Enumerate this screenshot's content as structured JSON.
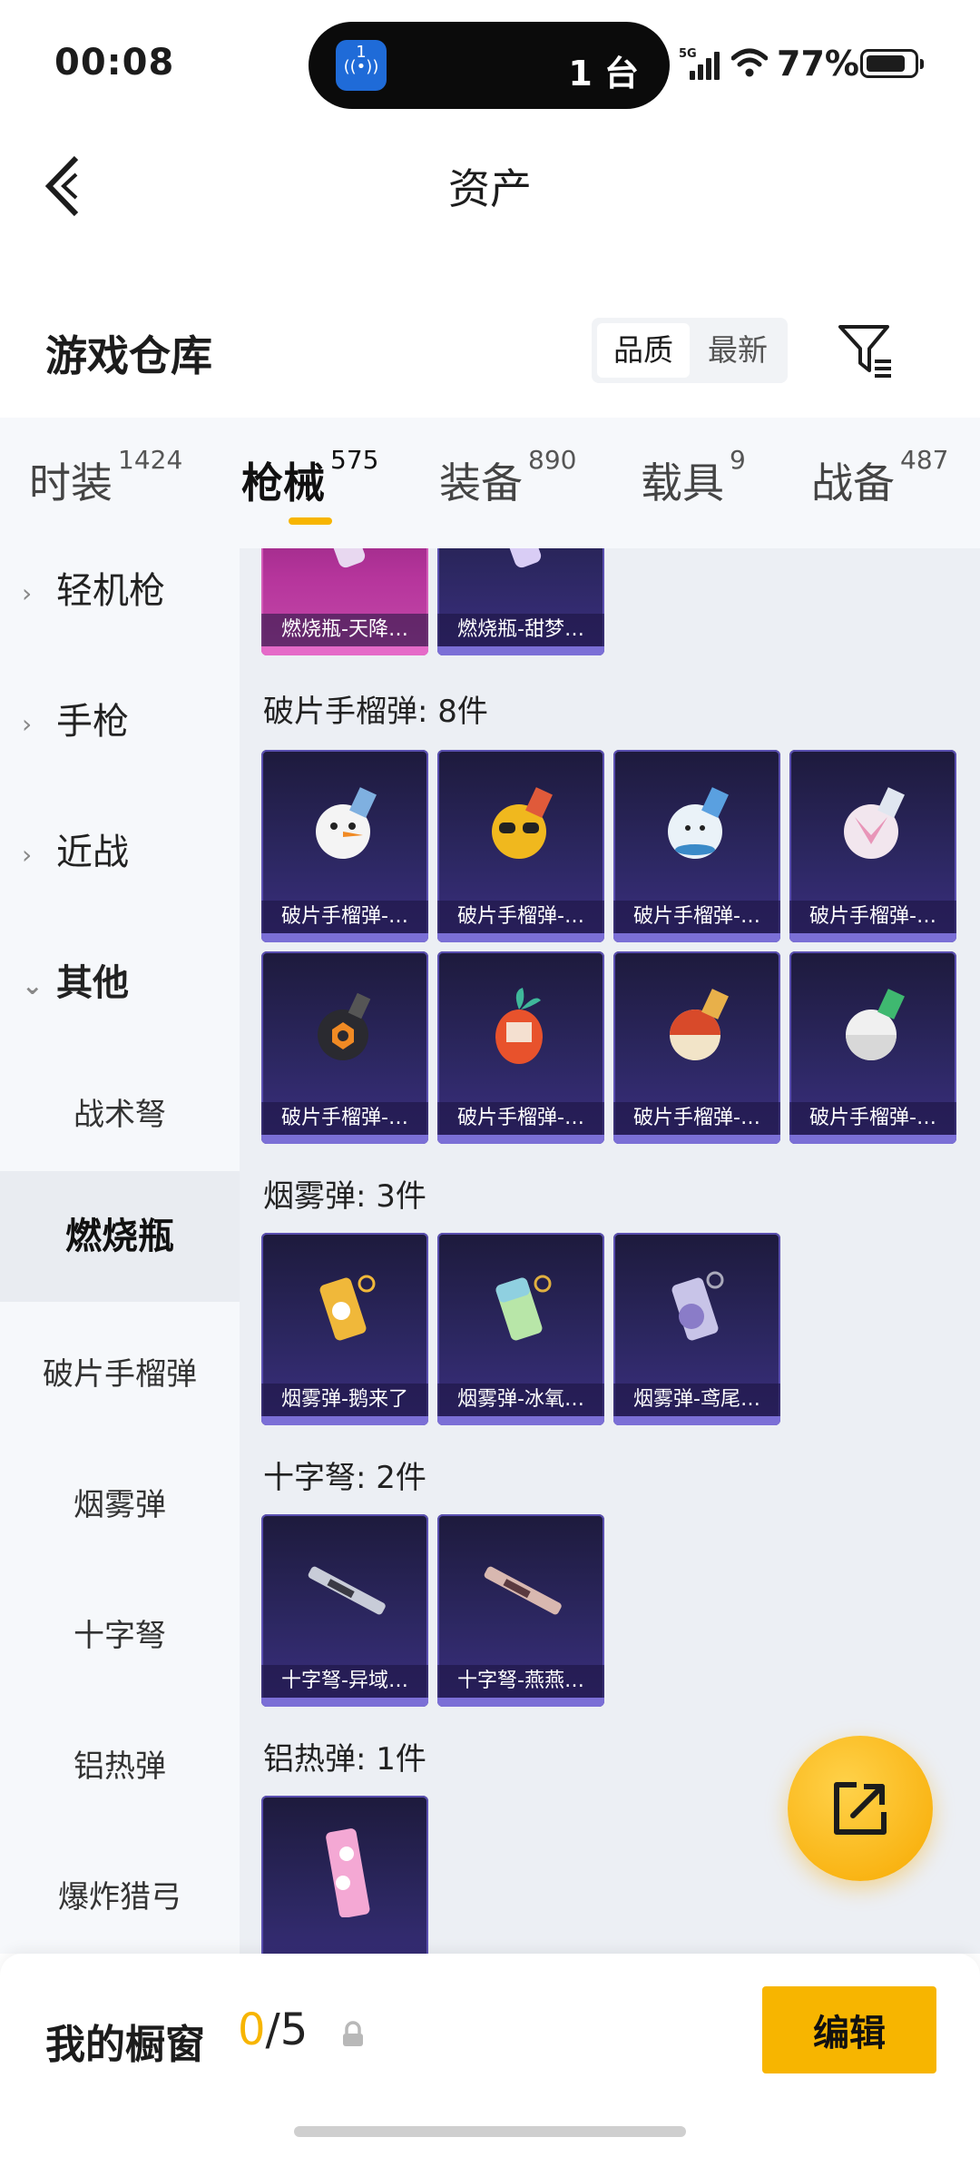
{
  "status_bar": {
    "time": "00:08",
    "island_icon": "1",
    "island_count": "1 台",
    "network": "5G",
    "battery": "77%"
  },
  "header": {
    "title": "资产"
  },
  "warehouse": {
    "title": "游戏仓库",
    "sort_options": [
      "品质",
      "最新"
    ],
    "sort_selected": "品质"
  },
  "tabs": [
    {
      "label": "时装",
      "count": "1424"
    },
    {
      "label": "枪械",
      "count": "575",
      "active": true
    },
    {
      "label": "装备",
      "count": "890"
    },
    {
      "label": "载具",
      "count": "9"
    },
    {
      "label": "战备",
      "count": "487"
    }
  ],
  "sidebar": {
    "categories": [
      "轻机枪",
      "手枪",
      "近战",
      "其他"
    ],
    "subcategories": [
      "战术弩",
      "燃烧瓶",
      "破片手榴弹",
      "烟雾弹",
      "十字弩",
      "铝热弹",
      "爆炸猎弓"
    ],
    "active": "燃烧瓶"
  },
  "sections": [
    {
      "label": "",
      "items": [
        "燃烧瓶-天降…",
        "燃烧瓶-甜梦…"
      ]
    },
    {
      "label": "破片手榴弹: 8件",
      "items": [
        "破片手榴弹-…",
        "破片手榴弹-…",
        "破片手榴弹-…",
        "破片手榴弹-…",
        "破片手榴弹-…",
        "破片手榴弹-…",
        "破片手榴弹-…",
        "破片手榴弹-…"
      ]
    },
    {
      "label": "烟雾弹: 3件",
      "items": [
        "烟雾弹-鹅来了",
        "烟雾弹-冰氧…",
        "烟雾弹-鸢尾…"
      ]
    },
    {
      "label": "十字弩: 2件",
      "items": [
        "十字弩-异域…",
        "十字弩-燕燕…"
      ]
    },
    {
      "label": "铝热弹: 1件",
      "items": [
        ""
      ]
    }
  ],
  "showcase": {
    "title": "我的橱窗",
    "current": "0",
    "total": "/5",
    "edit_label": "编辑"
  },
  "colors": {
    "accent": "#f7b500",
    "card_purple": "#2c2761",
    "card_pink": "#b6359c"
  }
}
